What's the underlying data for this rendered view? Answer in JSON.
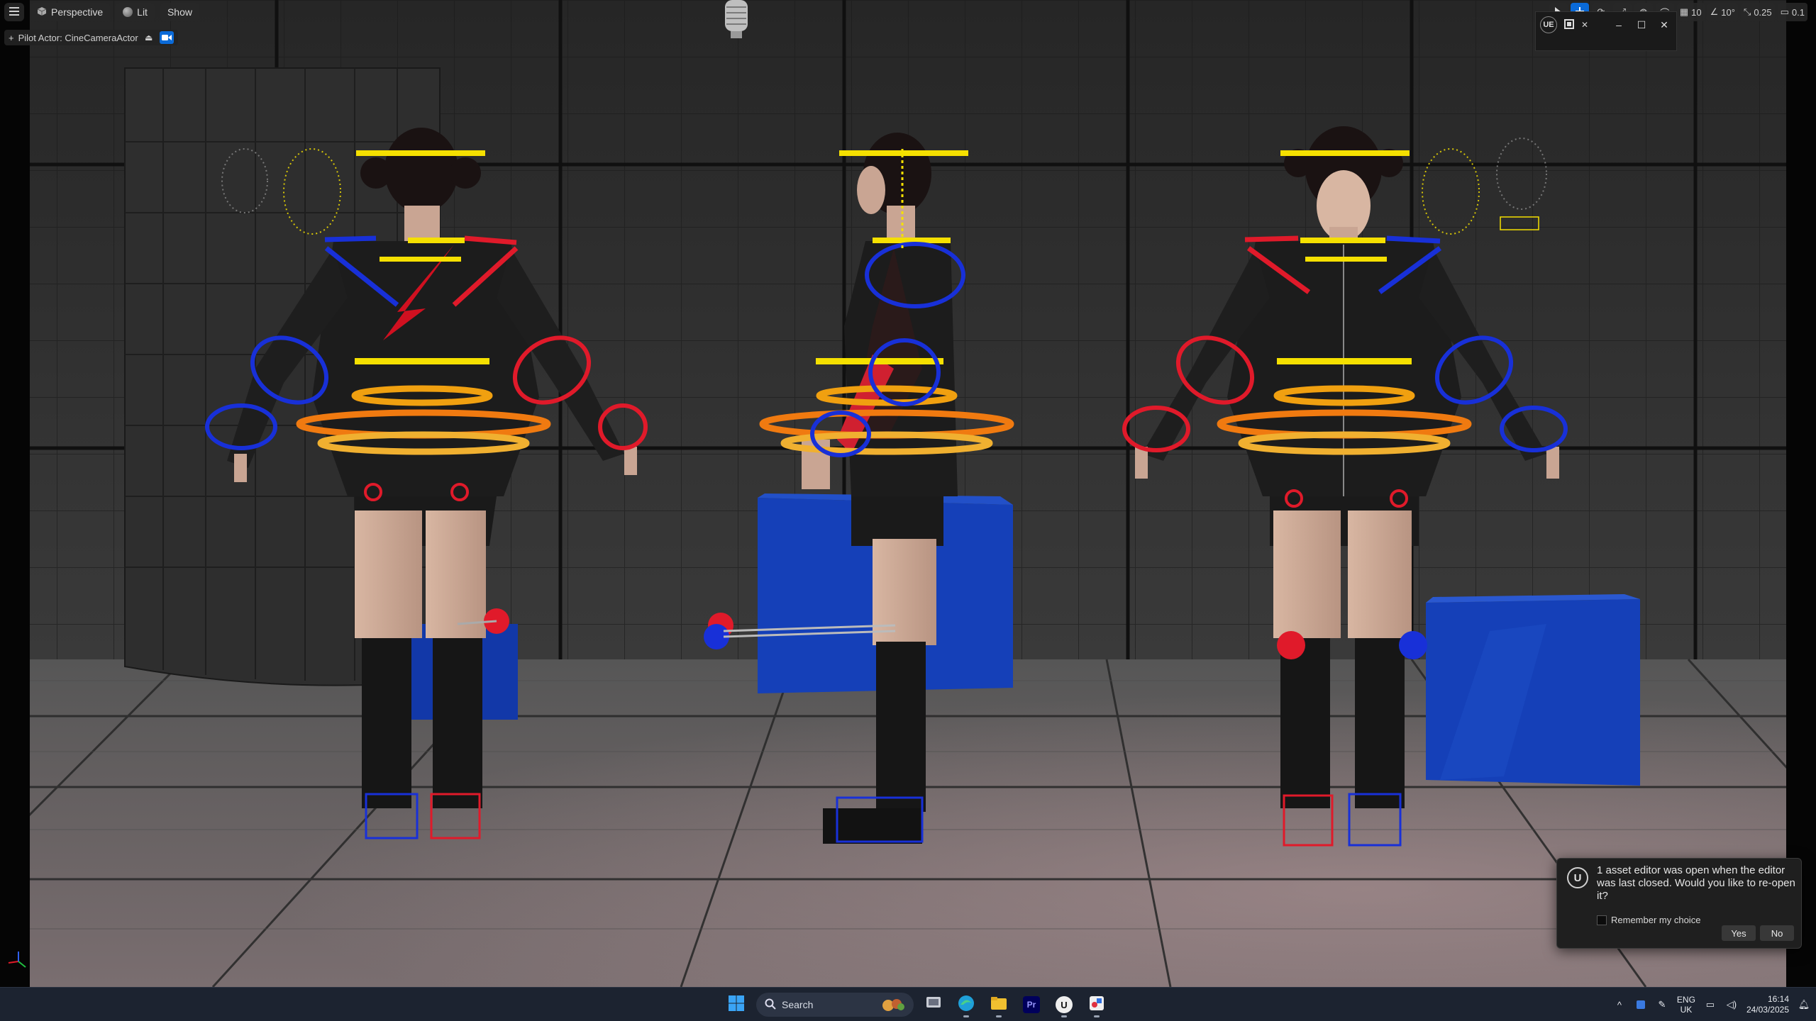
{
  "viewport": {
    "menu_icon": "hamburger-menu-icon",
    "perspective_label": "Perspective",
    "lit_label": "Lit",
    "show_label": "Show",
    "pilot_label": "Pilot Actor: CineCameraActor",
    "tools": {
      "grid_snap_value": "10",
      "rotation_snap_value": "10°",
      "scale_snap_value": "0.25",
      "camera_speed_value": "0.1"
    },
    "mini_window_logo": "UE"
  },
  "notification": {
    "message": "1 asset editor was open when the editor was last closed. Would you like to re-open it?",
    "remember_label": "Remember my choice",
    "remember_checked": false,
    "yes_label": "Yes",
    "no_label": "No",
    "logo_text": "U"
  },
  "taskbar": {
    "search_placeholder": "Search",
    "language_line1": "ENG",
    "language_line2": "UK",
    "time": "16:14",
    "date": "24/03/2025",
    "apps": [
      "start-icon",
      "search",
      "task-view-icon",
      "edge-icon",
      "file-explorer-icon",
      "premiere-pro-icon",
      "unreal-engine-icon",
      "snip-tool-icon"
    ],
    "premiere_label": "Pr",
    "unreal_label": "U"
  },
  "colors": {
    "accent_blue": "#0a6ad8",
    "control_yellow": "#f5e000",
    "control_red": "#e01a2a",
    "control_blue": "#1830d8",
    "control_orange": "#f07a10"
  }
}
